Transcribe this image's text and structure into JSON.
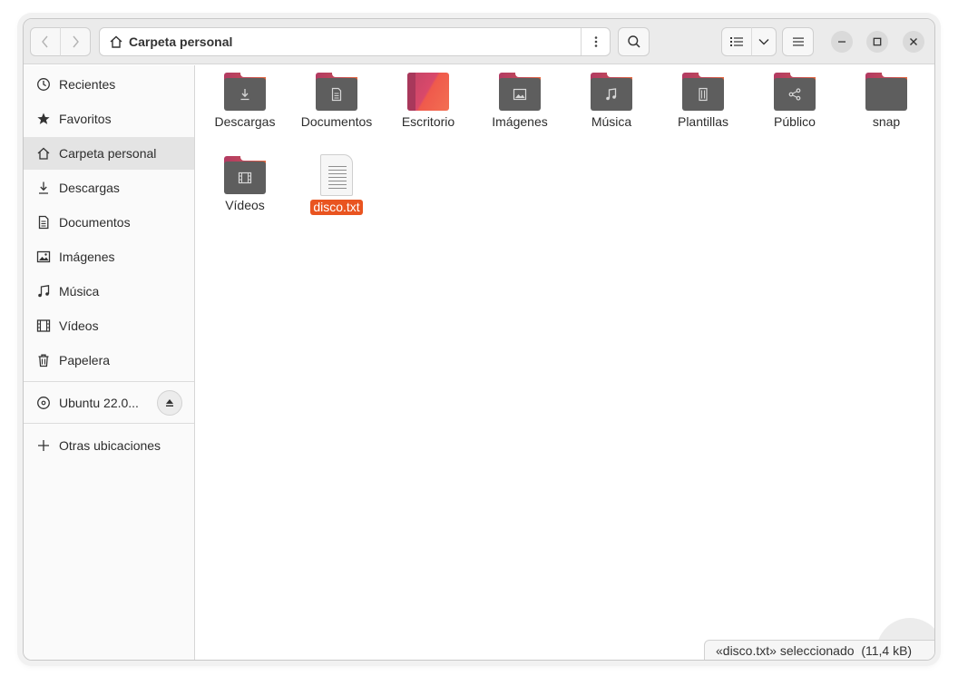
{
  "toolbar": {
    "path_title": "Carpeta personal",
    "icons": {
      "back": "chevron-left-icon",
      "forward": "chevron-right-icon",
      "home": "home-icon",
      "path_menu": "vertical-ellipsis-icon",
      "search": "search-icon",
      "view_list": "list-view-icon",
      "view_dropdown": "chevron-down-icon",
      "menu": "hamburger-menu-icon",
      "minimize": "minimize-icon",
      "maximize": "maximize-icon",
      "close": "close-icon"
    }
  },
  "sidebar": {
    "items": [
      {
        "label": "Recientes",
        "icon": "clock-icon"
      },
      {
        "label": "Favoritos",
        "icon": "star-icon"
      },
      {
        "label": "Carpeta personal",
        "icon": "home-icon",
        "active": true
      },
      {
        "label": "Descargas",
        "icon": "download-icon"
      },
      {
        "label": "Documentos",
        "icon": "document-icon"
      },
      {
        "label": "Imágenes",
        "icon": "image-icon"
      },
      {
        "label": "Música",
        "icon": "music-icon"
      },
      {
        "label": "Vídeos",
        "icon": "film-icon"
      },
      {
        "label": "Papelera",
        "icon": "trash-icon"
      }
    ],
    "device": {
      "label": "Ubuntu 22.0...",
      "icon": "disc-icon",
      "eject_icon": "eject-icon"
    },
    "other": {
      "label": "Otras ubicaciones",
      "icon": "plus-icon"
    }
  },
  "files": [
    {
      "name": "Descargas",
      "kind": "folder",
      "icon": "download-icon"
    },
    {
      "name": "Documentos",
      "kind": "folder",
      "icon": "document-icon"
    },
    {
      "name": "Escritorio",
      "kind": "desktop"
    },
    {
      "name": "Imágenes",
      "kind": "folder",
      "icon": "image-icon"
    },
    {
      "name": "Música",
      "kind": "folder",
      "icon": "music-icon"
    },
    {
      "name": "Plantillas",
      "kind": "folder",
      "icon": "template-icon"
    },
    {
      "name": "Público",
      "kind": "folder",
      "icon": "share-icon"
    },
    {
      "name": "snap",
      "kind": "folder",
      "icon": ""
    },
    {
      "name": "Vídeos",
      "kind": "folder",
      "icon": "film-icon"
    },
    {
      "name": "disco.txt",
      "kind": "text-file",
      "selected": true
    }
  ],
  "status": {
    "text": "«disco.txt» seleccionado  (11,4 kB)"
  },
  "colors": {
    "accent": "#e95420",
    "folder_body": "#5e5e5e",
    "folder_tab": "#b23a62"
  }
}
